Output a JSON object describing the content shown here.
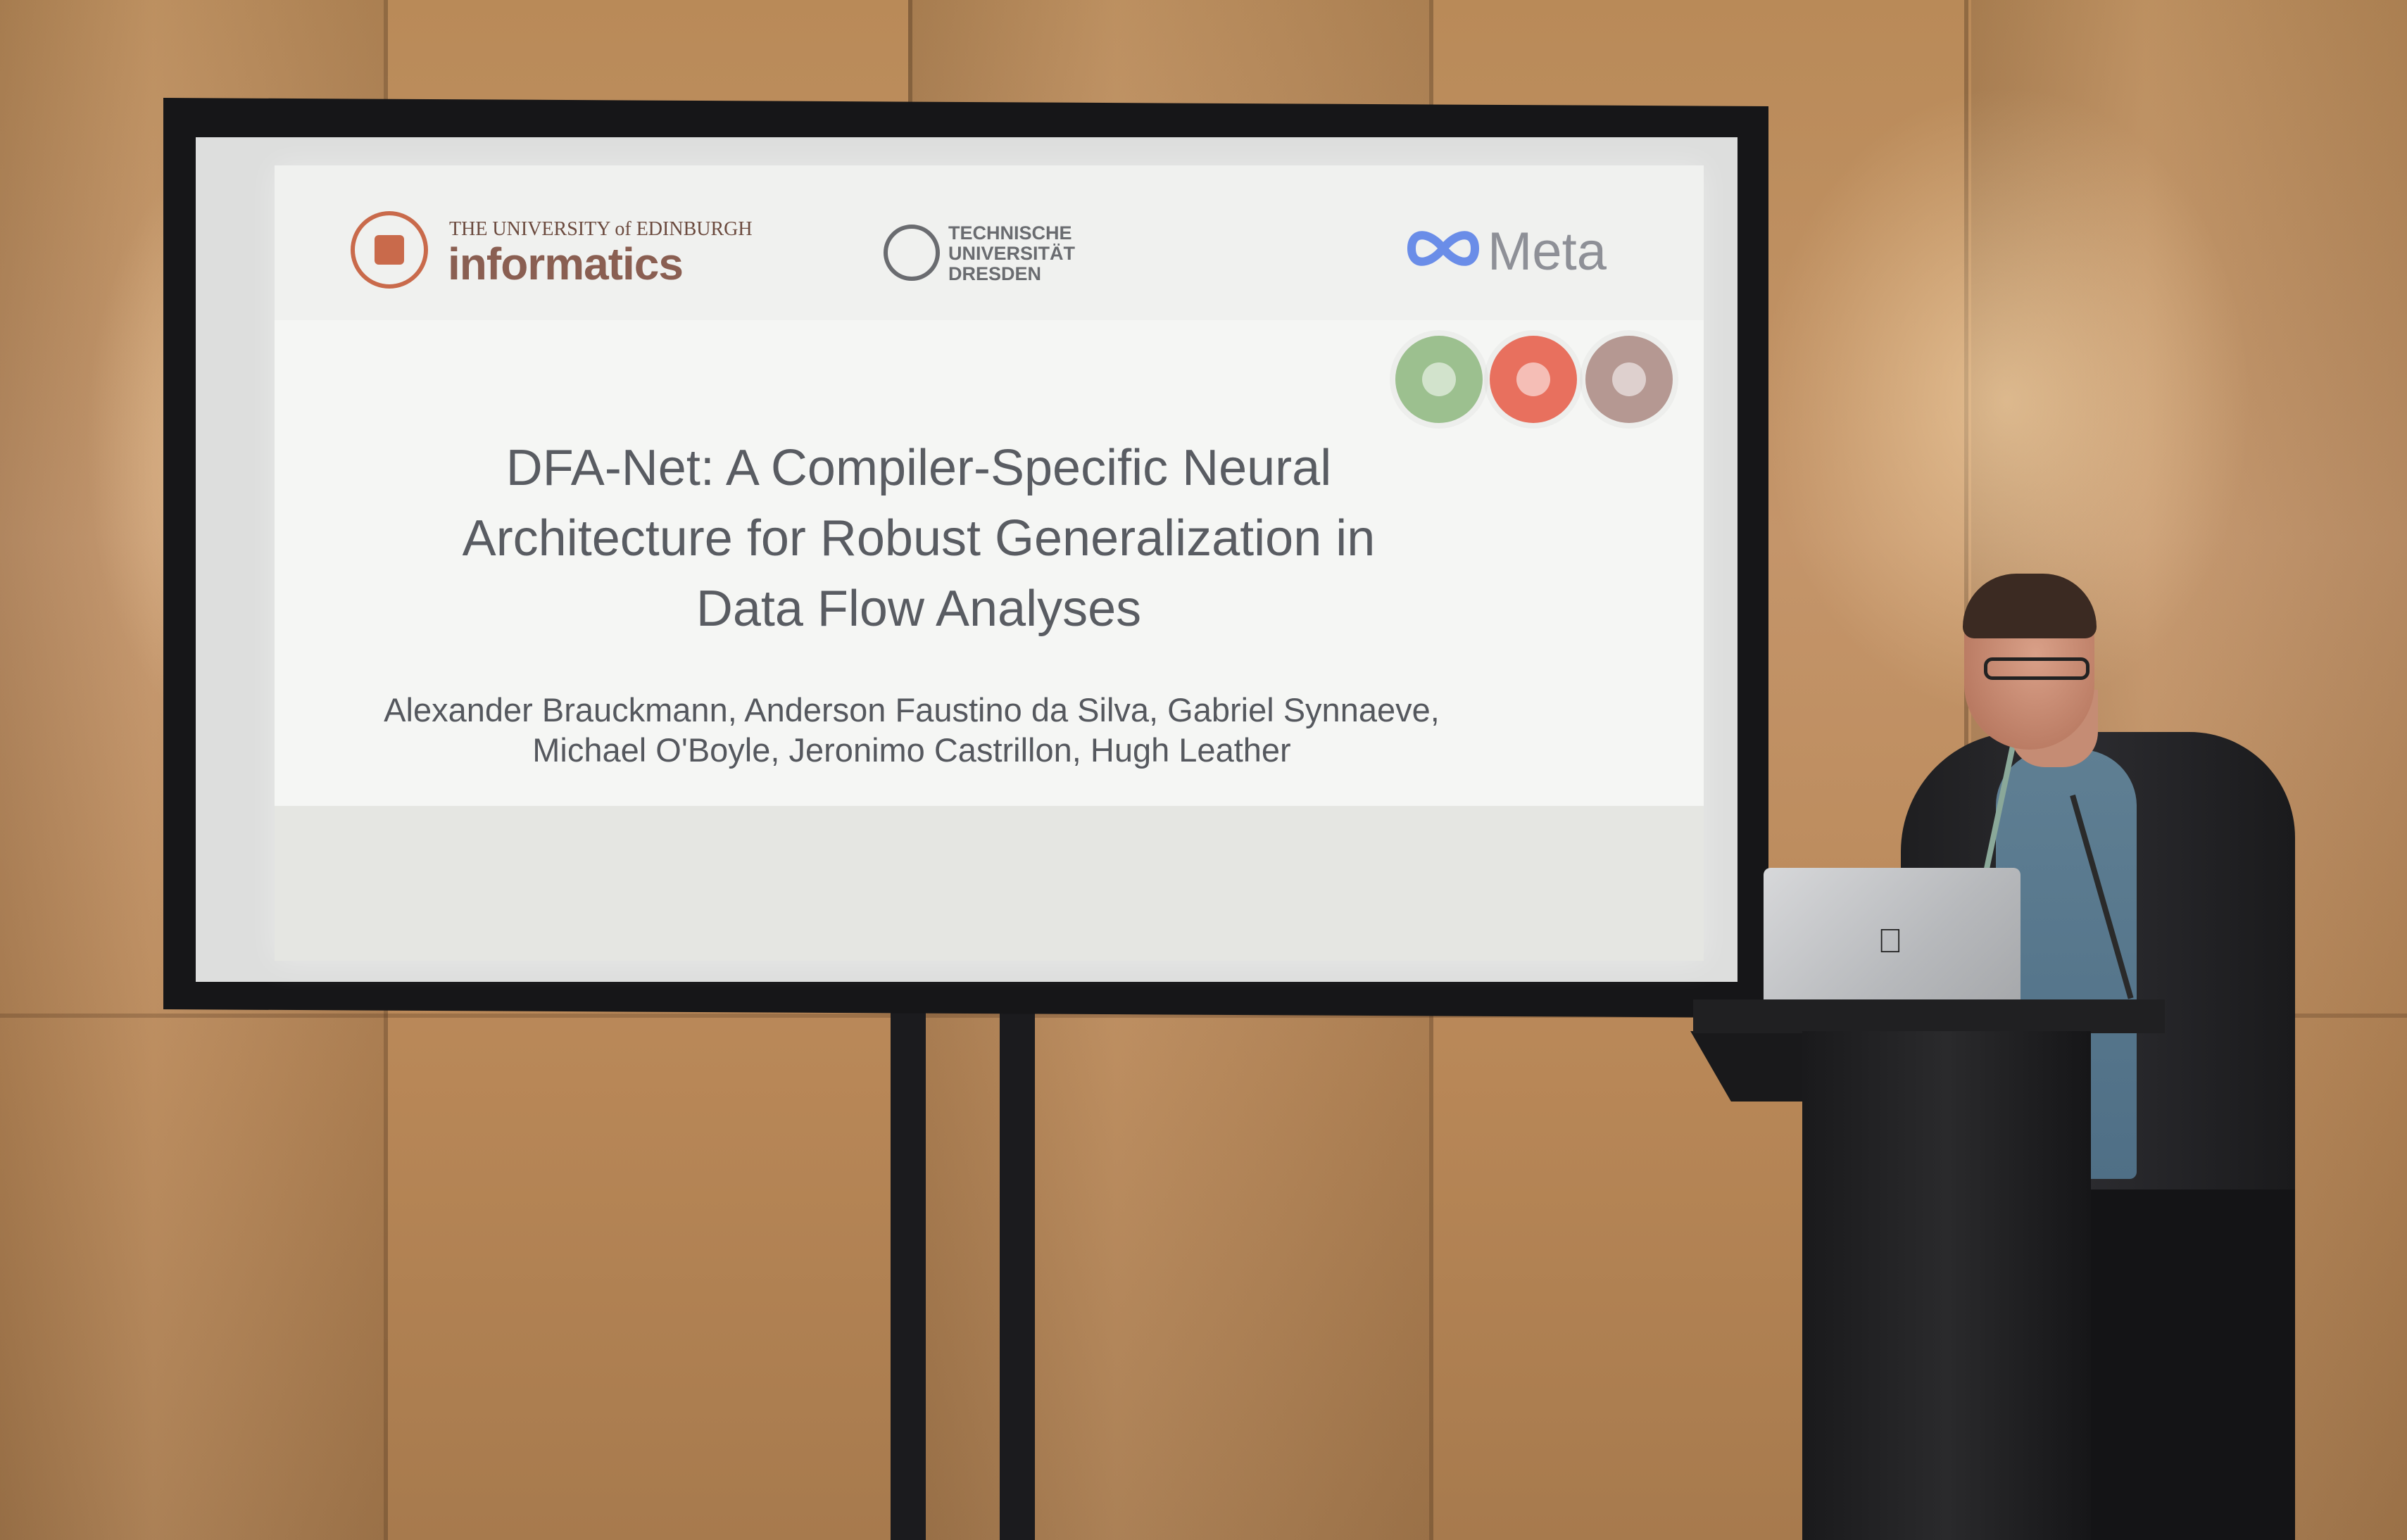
{
  "slide": {
    "logos": {
      "edinburgh_university": "THE UNIVERSITY of EDINBURGH",
      "edinburgh_informatics": "informatics",
      "tud": [
        "TECHNISCHE",
        "UNIVERSITÄT",
        "DRESDEN"
      ],
      "meta": "Meta"
    },
    "title": [
      "DFA-Net: A Compiler-Specific Neural",
      "Architecture for Robust Generalization in",
      "Data Flow Analyses"
    ],
    "authors": [
      "Alexander Brauckmann, Anderson Faustino da Silva, Gabriel Synnaeve,",
      "Michael O'Boyle, Jeronimo Castrillon, Hugh Leather"
    ],
    "badge_colors": [
      "#9cc08f",
      "#e8705e",
      "#b59892"
    ]
  },
  "scene": {
    "laptop_logo": "apple-logo-icon"
  }
}
